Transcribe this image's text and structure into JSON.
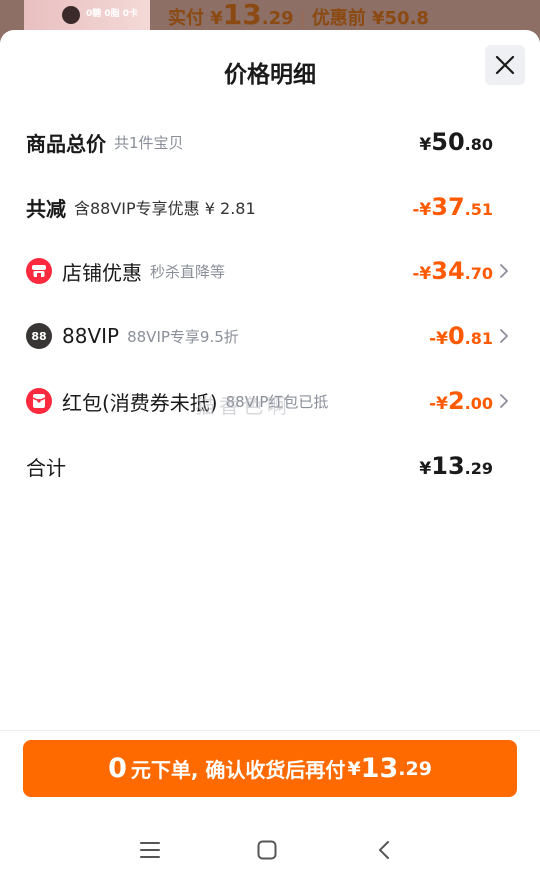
{
  "background": {
    "thumb_tag": "0糖 0脂 0卡",
    "price_prefix": "实付 ¥",
    "price_int": "13",
    "price_dec": ".29",
    "separator": "|",
    "original_label": "优惠前 ¥50.8"
  },
  "sheet": {
    "title": "价格明细"
  },
  "rows": [
    {
      "label": "商品总价",
      "sub": "共1件宝贝",
      "sym": "¥",
      "int": "50",
      "dec": ".80",
      "color": "#1a1a1a"
    },
    {
      "label": "共减",
      "sub": "含88VIP专享优惠 ¥ 2.81",
      "sym": "-¥",
      "int": "37",
      "dec": ".51",
      "color": "#ff5a00"
    },
    {
      "label": "店铺优惠",
      "sub": "秒杀直降等",
      "sym": "-¥",
      "int": "34",
      "dec": ".70",
      "color": "#ff5a00",
      "icon": "shop-icon"
    },
    {
      "label": "88VIP",
      "sub": "88VIP专享9.5折",
      "sym": "-¥",
      "int": "0",
      "dec": ".81",
      "color": "#ff5a00",
      "icon": "vip-88-icon",
      "icon_text": "88"
    },
    {
      "label": "红包(消费券未抵)",
      "sub": "88VIP红包已抵",
      "sym": "-¥",
      "int": "2",
      "dec": ".00",
      "color": "#ff5a00",
      "icon": "red-packet-icon"
    },
    {
      "label": "合计",
      "sym": "¥",
      "int": "13",
      "dec": ".29",
      "color": "#1a1a1a"
    }
  ],
  "watermark": "猫香色啊",
  "cta": {
    "n": "0",
    "text": "元下单, 确认收货后再付",
    "sym": "¥",
    "int": "13",
    "dec": ".29",
    "color": "#ff6a00"
  },
  "navbar": {
    "icons": [
      "menu-icon",
      "home-icon",
      "back-icon"
    ]
  }
}
